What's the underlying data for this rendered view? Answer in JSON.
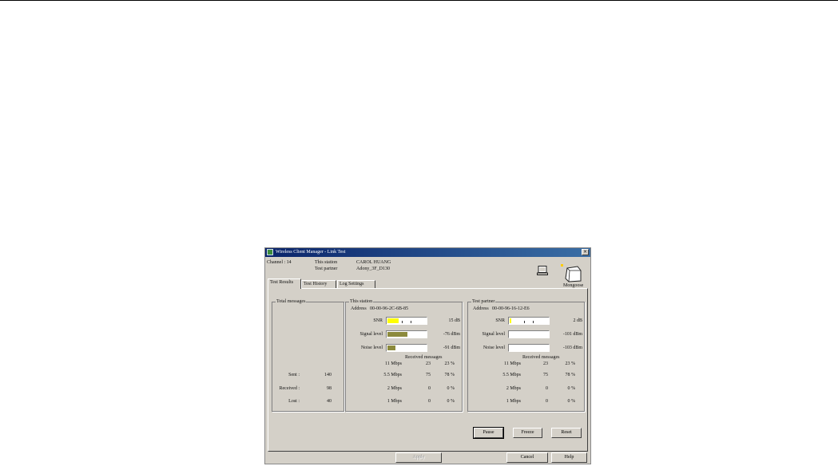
{
  "window": {
    "title": "Wireless Client Manager - Link Test",
    "close_glyph": "×",
    "icon": "app-icon"
  },
  "header": {
    "channel": "Channel : 14",
    "this_station_label": "This station",
    "this_station_value": "CAROL HUANG",
    "test_partner_label": "Test partner",
    "test_partner_value": "Adony_3F_D130",
    "partner_device_label": "Mongoose"
  },
  "tabs": [
    {
      "label": "Test Results",
      "active": true
    },
    {
      "label": "Test History",
      "active": false
    },
    {
      "label": "Log Settings",
      "active": false
    }
  ],
  "total_messages": {
    "title": "Total messages",
    "rows": [
      {
        "label": "Sent :",
        "value": "140"
      },
      {
        "label": "Received :",
        "value": "98"
      },
      {
        "label": "Lost :",
        "value": "40"
      }
    ]
  },
  "this_station": {
    "title": "This station",
    "address_label": "Address",
    "address_value": "00-00-96-2C-6B-85",
    "meters": [
      {
        "label": "SNR",
        "value": "15 dB",
        "level": 0.3,
        "color": "#ffff00",
        "ticks": true
      },
      {
        "label": "Signal level",
        "value": "-76 dBm",
        "level": 0.52,
        "color": "#8c8a3c",
        "ticks": false
      },
      {
        "label": "Noise level",
        "value": "-91 dBm",
        "level": 0.2,
        "color": "#8c8a3c",
        "ticks": false
      }
    ],
    "received_title": "Received messages",
    "rates": [
      {
        "rate": "11 Mbps",
        "count": "23",
        "pct": "23 %"
      },
      {
        "rate": "5.5 Mbps",
        "count": "75",
        "pct": "78 %"
      },
      {
        "rate": "2 Mbps",
        "count": "0",
        "pct": "0 %"
      },
      {
        "rate": "1 Mbps",
        "count": "0",
        "pct": "0 %"
      }
    ]
  },
  "test_partner": {
    "title": "Test partner",
    "address_label": "Address",
    "address_value": "00-00-96-16-12-E6",
    "meters": [
      {
        "label": "SNR",
        "value": "2 dB",
        "level": 0.04,
        "color": "#ffff00",
        "ticks": true
      },
      {
        "label": "Signal level",
        "value": "-101 dBm",
        "level": 0,
        "color": "#8c8a3c",
        "ticks": false
      },
      {
        "label": "Noise level",
        "value": "-103 dBm",
        "level": 0,
        "color": "#8c8a3c",
        "ticks": false
      }
    ],
    "received_title": "Received messages",
    "rates": [
      {
        "rate": "11 Mbps",
        "count": "23",
        "pct": "23 %"
      },
      {
        "rate": "5.5 Mbps",
        "count": "75",
        "pct": "78 %"
      },
      {
        "rate": "2 Mbps",
        "count": "0",
        "pct": "0 %"
      },
      {
        "rate": "1 Mbps",
        "count": "0",
        "pct": "0 %"
      }
    ]
  },
  "buttons": {
    "pause": "Pause",
    "freeze": "Freeze",
    "reset": "Reset",
    "apply": "Apply",
    "cancel": "Cancel",
    "help": "Help"
  }
}
